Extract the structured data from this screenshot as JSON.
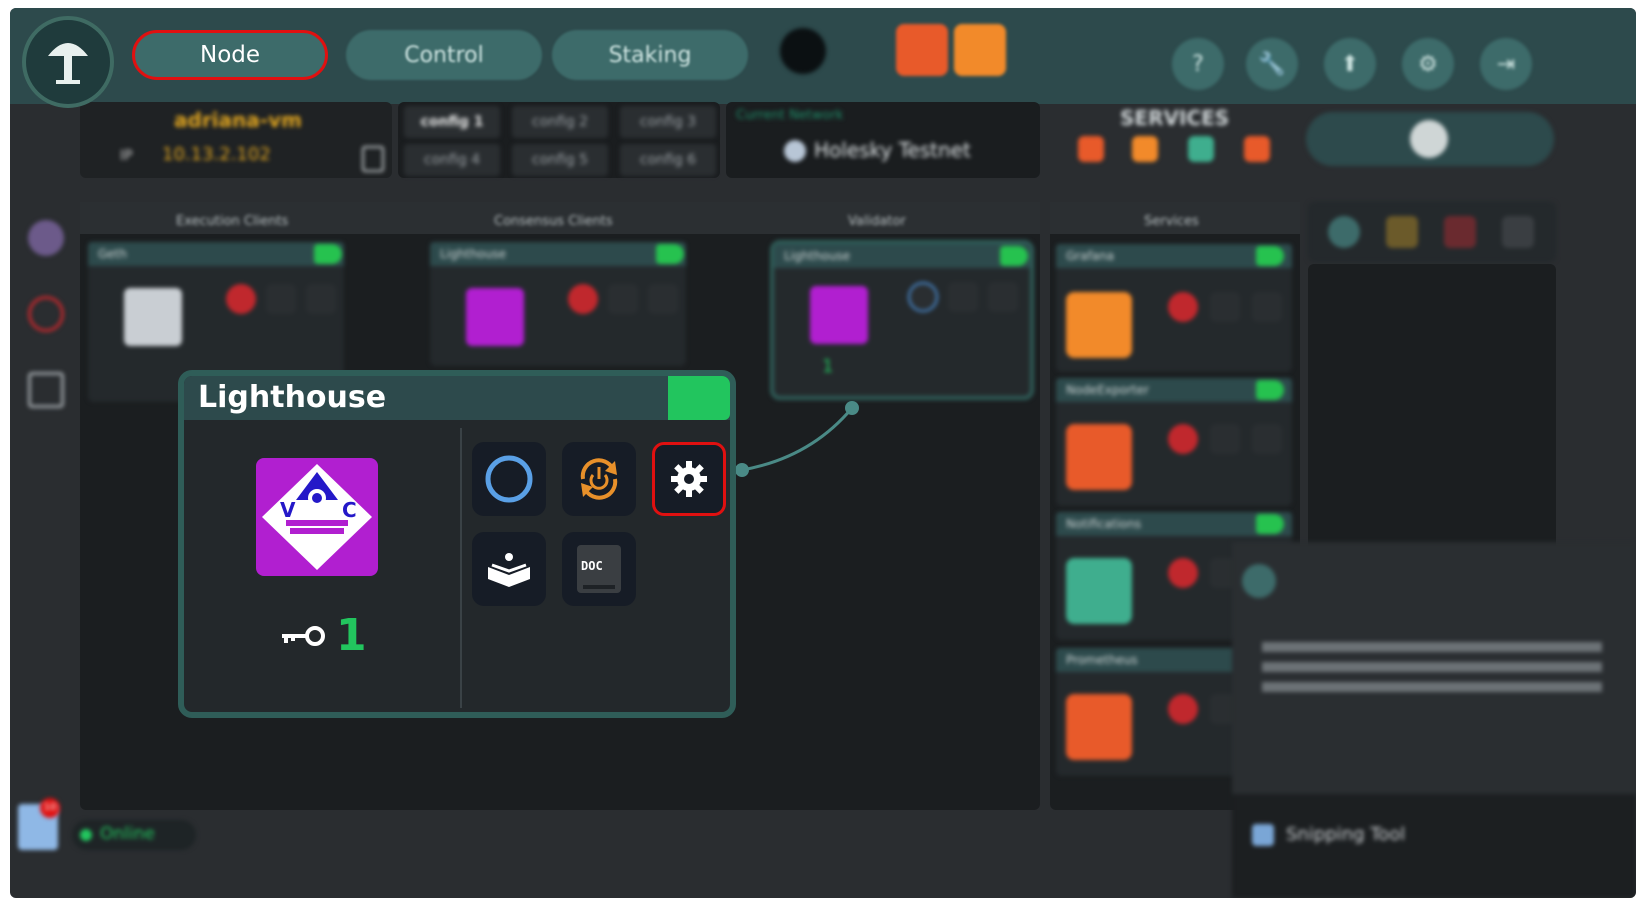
{
  "app": {
    "nav_tabs": [
      {
        "label": "Node",
        "active": true
      },
      {
        "label": "Control",
        "active": false
      },
      {
        "label": "Staking",
        "active": false
      }
    ],
    "top_icons": [
      "help-icon",
      "wrench-icon",
      "upload-icon",
      "settings-icon",
      "logout-icon"
    ],
    "help_glyph": "?",
    "accent_color": "#2d4a4c",
    "highlight_color": "#e01010"
  },
  "server": {
    "name": "adriana-vm",
    "ip_label": "IP",
    "ip": "10.13.2.102"
  },
  "configs": [
    "config 1",
    "config 2",
    "config 3",
    "config 4",
    "config 5",
    "config 6"
  ],
  "network": {
    "label": "Current Network",
    "name": "Holesky Testnet"
  },
  "services_header": {
    "title": "SERVICES"
  },
  "columns": {
    "execution": "Execution Clients",
    "consensus": "Consensus Clients",
    "validator": "Validator",
    "services": "Services"
  },
  "cards": {
    "execution": {
      "name": "Geth"
    },
    "consensus": {
      "name": "Lighthouse"
    },
    "validator": {
      "name": "Lighthouse",
      "keys": "1"
    }
  },
  "services_list": [
    {
      "name": "Grafana"
    },
    {
      "name": "NodeExporter"
    },
    {
      "name": "Notifications"
    },
    {
      "name": "Prometheus"
    }
  ],
  "popup": {
    "title": "Lighthouse",
    "icon_letters": [
      "V",
      "C"
    ],
    "key_count": "1",
    "buttons": [
      {
        "name": "status-ring-icon",
        "selected": false
      },
      {
        "name": "restart-icon",
        "selected": false
      },
      {
        "name": "settings-icon",
        "selected": true
      },
      {
        "name": "logs-book-icon",
        "selected": false
      },
      {
        "name": "doc-icon",
        "selected": false
      }
    ],
    "doc_label": "DOC"
  },
  "status": {
    "label": "Online",
    "notification_count": "10"
  },
  "taskbar_preview": {
    "label": "Snipping Tool"
  }
}
